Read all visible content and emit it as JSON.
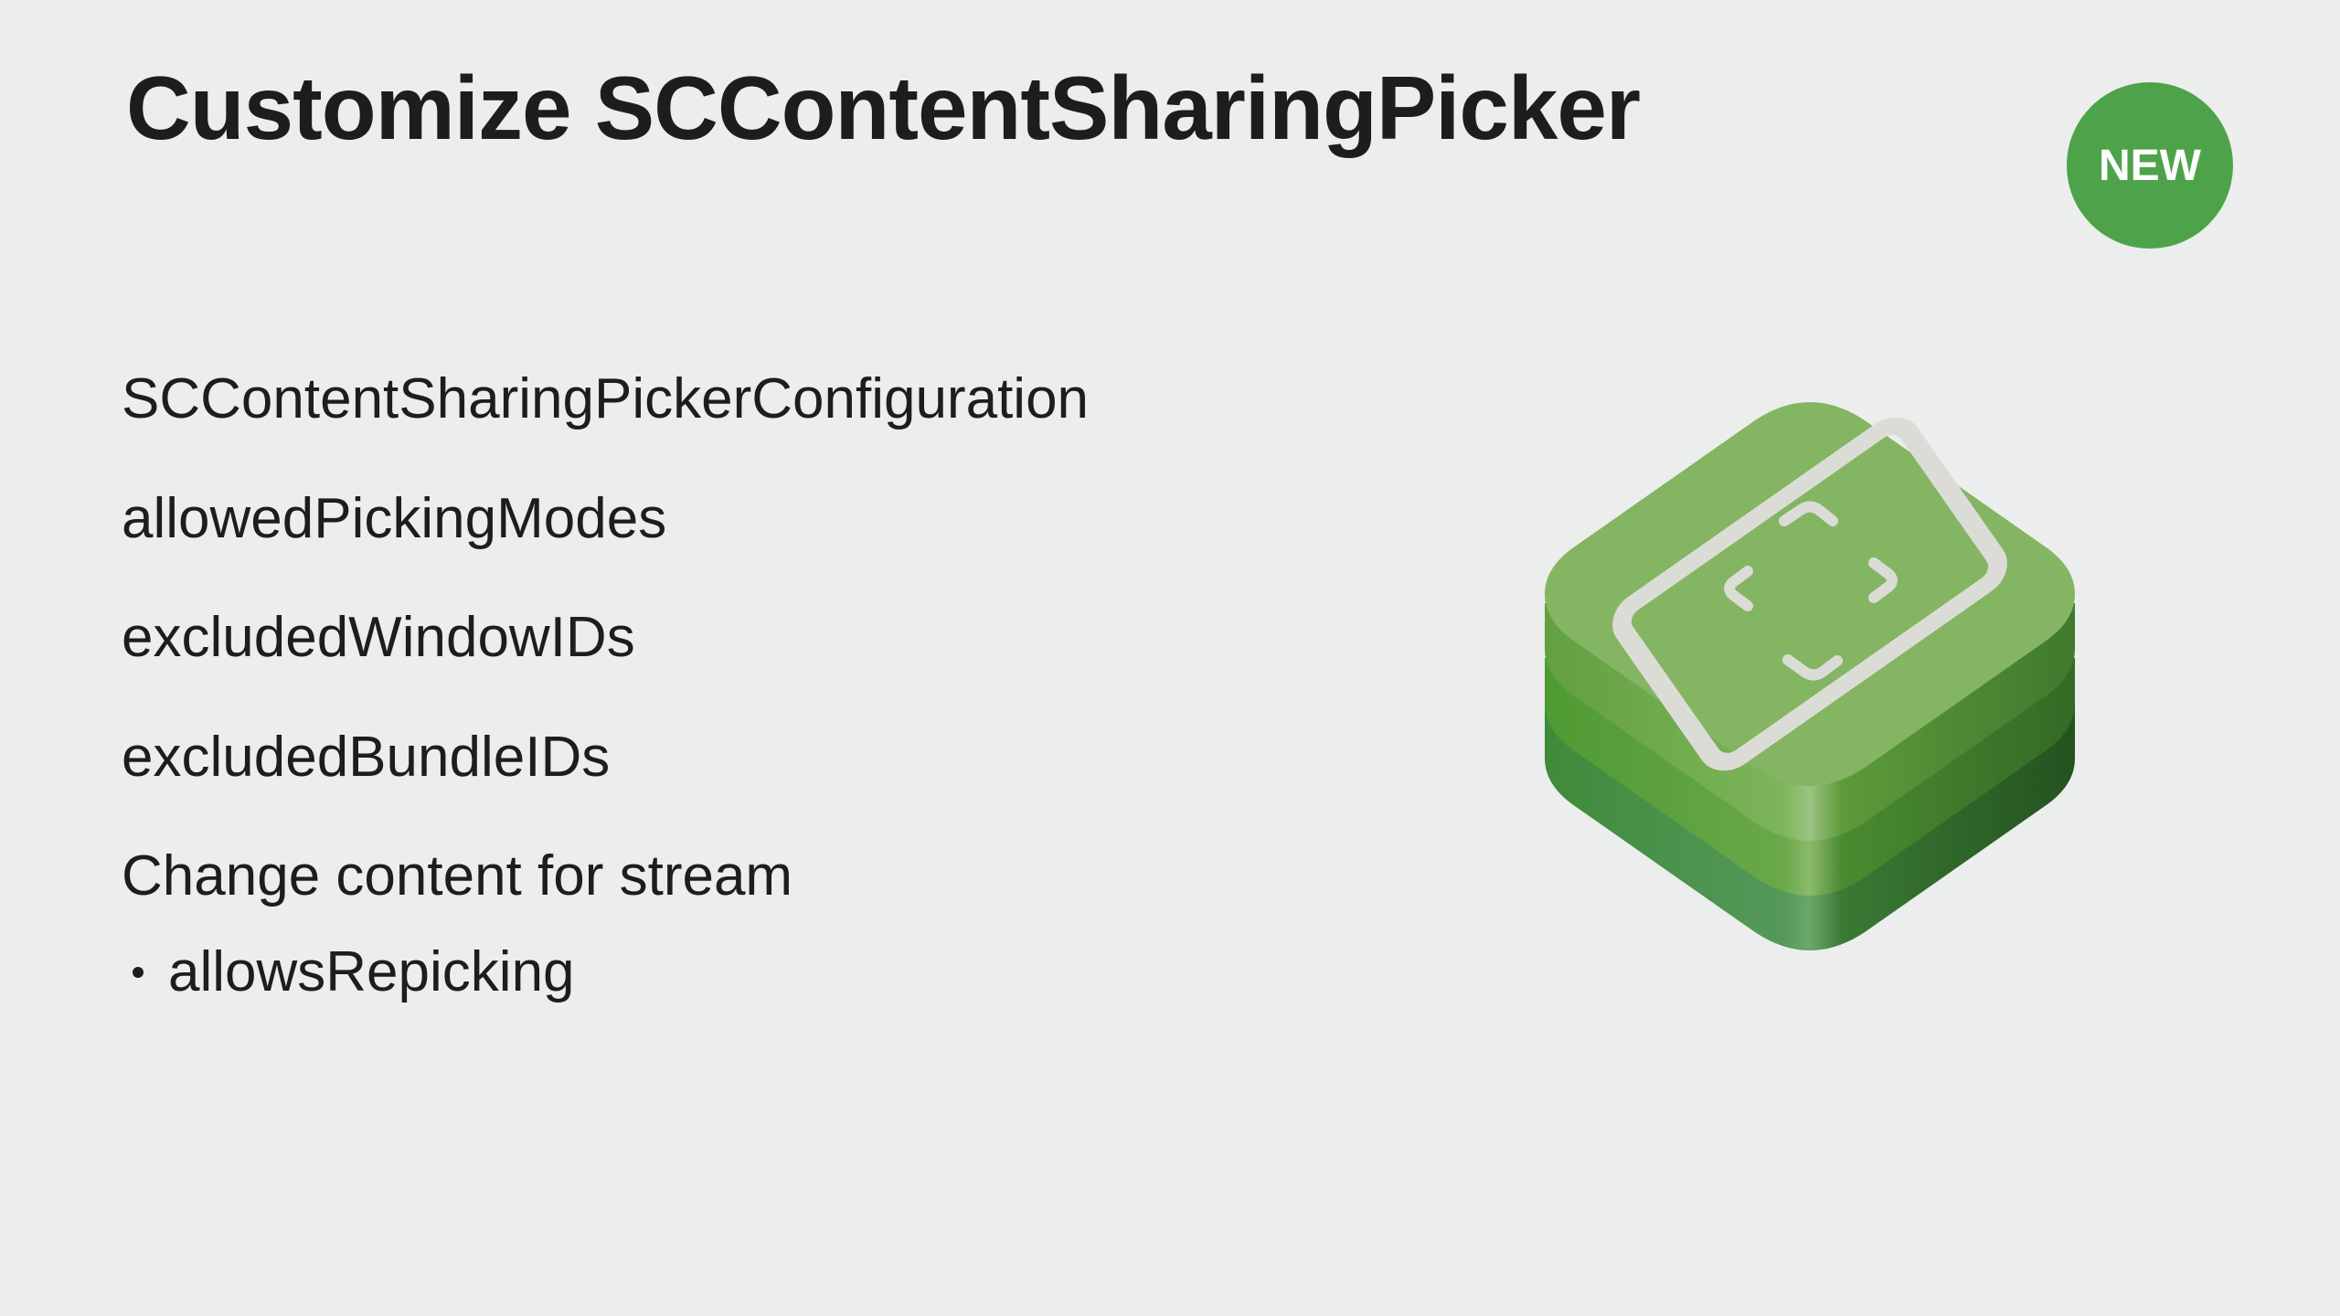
{
  "slide": {
    "title": "Customize SCContentSharingPicker",
    "badge": "NEW",
    "items": [
      "SCContentSharingPickerConfiguration",
      "allowedPickingModes",
      "excludedWindowIDs",
      "excludedBundleIDs",
      "Change content for stream"
    ],
    "sub_items": [
      "allowsRepicking"
    ],
    "icon": "screencapturekit-app-icon",
    "colors": {
      "background": "#eceeed",
      "text": "#1d1d1f",
      "badge": "#4ea34a",
      "icon_top": "#84b563",
      "icon_layer_light": "#5ea33d",
      "icon_layer_dark": "#2f6e2c"
    }
  }
}
